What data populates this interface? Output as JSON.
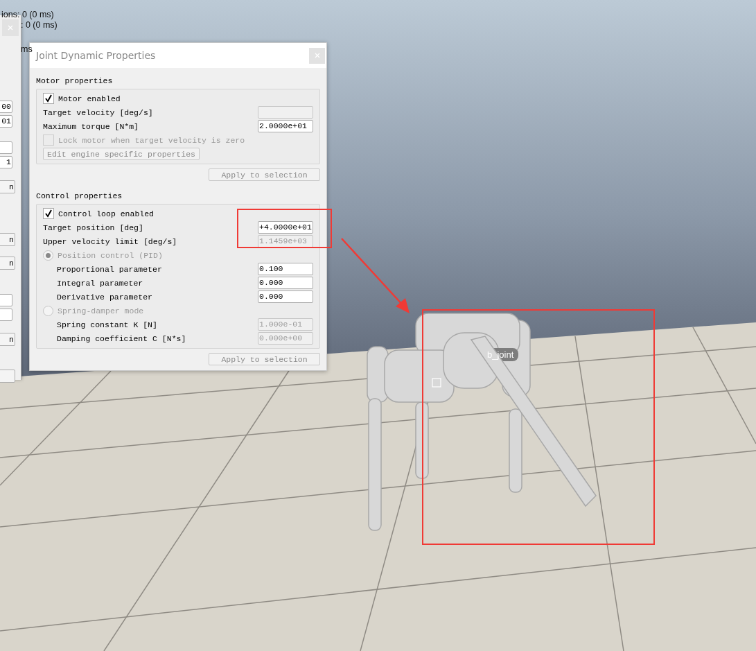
{
  "overlay_text": [
    "ions: 0 (0 ms)",
    ": 0 (0 ms)",
    "ms"
  ],
  "left_window": {
    "fields": [
      "00",
      "01",
      "1"
    ],
    "buttons": [
      "n",
      "n",
      "n",
      "n"
    ]
  },
  "dialog": {
    "title": "Joint Dynamic Properties",
    "sections": [
      {
        "heading": "Motor properties",
        "items": [
          {
            "kind": "checkbox",
            "label": "Motor enabled",
            "checked": true,
            "disabled": false
          },
          {
            "kind": "field",
            "label": "Target velocity [deg/s]",
            "disabled": true
          },
          {
            "kind": "field",
            "label": "Maximum torque [N*m]",
            "value": "2.0000e+01",
            "disabled": false
          },
          {
            "kind": "checkbox",
            "label": "Lock motor when target velocity is zero",
            "checked": false,
            "disabled": true
          },
          {
            "kind": "button",
            "label": "Edit engine specific properties",
            "disabled": true
          }
        ],
        "apply": {
          "label": "Apply to selection",
          "disabled": true
        }
      },
      {
        "heading": "Control properties",
        "items": [
          {
            "kind": "checkbox",
            "label": "Control loop enabled",
            "checked": true,
            "disabled": false
          },
          {
            "kind": "field",
            "label": "Target position [deg]",
            "value": "+4.0000e+01",
            "disabled": false
          },
          {
            "kind": "field",
            "label": "Upper velocity limit [deg/s]",
            "value": "1.1459e+03",
            "disabled": true
          },
          {
            "kind": "radio",
            "label": "Position control (PID)",
            "selected": true,
            "disabled": true,
            "children": [
              {
                "kind": "field",
                "label": "Proportional parameter",
                "value": "0.100",
                "disabled": false
              },
              {
                "kind": "field",
                "label": "Integral parameter",
                "value": "0.000",
                "disabled": false
              },
              {
                "kind": "field",
                "label": "Derivative parameter",
                "value": "0.000",
                "disabled": false
              }
            ]
          },
          {
            "kind": "radio",
            "label": "Spring-damper mode",
            "selected": false,
            "disabled": true,
            "children": [
              {
                "kind": "field",
                "label": "Spring constant K [N]",
                "value": "1.000e-01",
                "disabled": true
              },
              {
                "kind": "field",
                "label": "Damping coefficient C [N*s]",
                "value": "0.000e+00",
                "disabled": true
              }
            ]
          }
        ],
        "apply": {
          "label": "Apply to selection",
          "disabled": true
        }
      }
    ]
  },
  "scene": {
    "joint_label": "b_joint"
  }
}
